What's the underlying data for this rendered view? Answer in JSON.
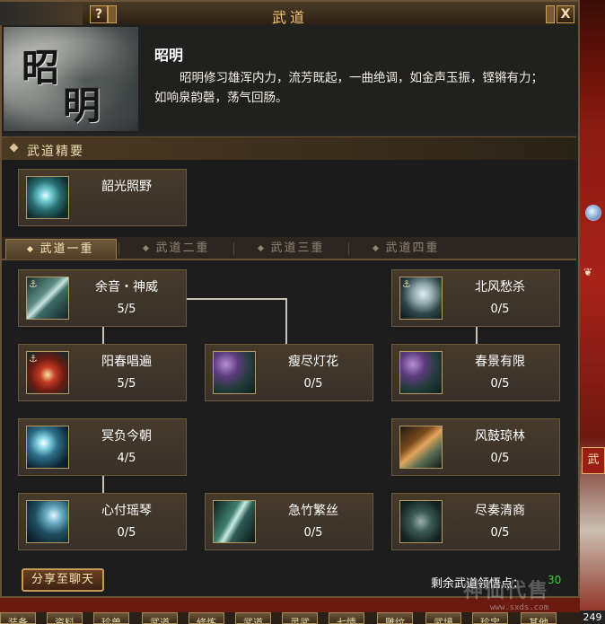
{
  "window": {
    "title": "武道",
    "help_label": "?",
    "close_label": "X"
  },
  "header": {
    "portrait_chars": [
      "昭",
      "明"
    ],
    "skill_name": "昭明",
    "description": "昭明修习雄浑内力，流芳既起，一曲绝调，如金声玉振，铿锵有力；如响泉韵磬，荡气回肠。"
  },
  "summary": {
    "section_label": "武道精要",
    "card": {
      "name": "韶光照野",
      "icon": "teal-burst-icon"
    }
  },
  "tabs": [
    {
      "label": "武道一重",
      "active": true
    },
    {
      "label": "武道二重",
      "active": false
    },
    {
      "label": "武道三重",
      "active": false
    },
    {
      "label": "武道四重",
      "active": false
    }
  ],
  "skills": [
    {
      "name": "余音・神威",
      "level": "5/5",
      "icon": "harp-icon",
      "col": 0,
      "row": 0
    },
    {
      "name": "阳春唱遍",
      "level": "5/5",
      "icon": "red-flower-icon",
      "col": 0,
      "row": 1
    },
    {
      "name": "瘦尽灯花",
      "level": "0/5",
      "icon": "purple-swirl-icon",
      "col": 1,
      "row": 1
    },
    {
      "name": "北风愁杀",
      "level": "0/5",
      "icon": "ghost-icon",
      "col": 2,
      "row": 0
    },
    {
      "name": "春景有限",
      "level": "0/5",
      "icon": "purple-orb-icon",
      "col": 2,
      "row": 1
    },
    {
      "name": "冥负今朝",
      "level": "4/5",
      "icon": "cyan-burst-icon",
      "col": 0,
      "row": 2
    },
    {
      "name": "风鼓琼林",
      "level": "0/5",
      "icon": "orange-slash-icon",
      "col": 2,
      "row": 2
    },
    {
      "name": "心付瑶琴",
      "level": "0/5",
      "icon": "wave-icon",
      "col": 0,
      "row": 3
    },
    {
      "name": "急竹繁丝",
      "level": "0/5",
      "icon": "flute-icon",
      "col": 1,
      "row": 3
    },
    {
      "name": "尽奏清商",
      "level": "0/5",
      "icon": "ring-icon",
      "col": 2,
      "row": 3
    }
  ],
  "footer": {
    "share_label": "分享至聊天",
    "points_label": "剩余武道领悟点：",
    "points_value": "30"
  },
  "watermark": {
    "text": "神仙代售",
    "url": "www.sxds.com"
  },
  "side": {
    "tag": "武",
    "number": "249"
  },
  "menubar": [
    "装备",
    "资料",
    "珍兽",
    "武道",
    "修炼",
    "武道",
    "灵武",
    "七情",
    "雕纹",
    "武境",
    "珍宝",
    "其他"
  ]
}
